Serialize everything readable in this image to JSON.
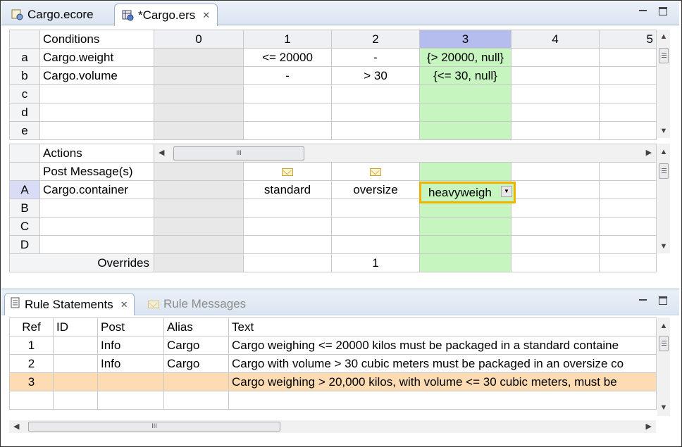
{
  "editor": {
    "tabs": [
      {
        "label": "Cargo.ecore",
        "icon": "ecore-model-icon",
        "active": false
      },
      {
        "label": "*Cargo.ers",
        "icon": "ruleflow-icon",
        "active": true
      }
    ]
  },
  "conditions": {
    "title": "Conditions",
    "columns": [
      "0",
      "1",
      "2",
      "3",
      "4",
      "5"
    ],
    "selected_column": "3",
    "rows": [
      {
        "label": "a",
        "name": "Cargo.weight",
        "cells": [
          "",
          "<= 20000",
          "-",
          "{> 20000, null}",
          "",
          ""
        ]
      },
      {
        "label": "b",
        "name": "Cargo.volume",
        "cells": [
          "",
          "-",
          "> 30",
          "{<= 30, null}",
          "",
          ""
        ]
      },
      {
        "label": "c",
        "name": "",
        "cells": [
          "",
          "",
          "",
          "",
          "",
          ""
        ]
      },
      {
        "label": "d",
        "name": "",
        "cells": [
          "",
          "",
          "",
          "",
          "",
          ""
        ]
      },
      {
        "label": "e",
        "name": "",
        "cells": [
          "",
          "",
          "",
          "",
          "",
          ""
        ]
      }
    ]
  },
  "actions": {
    "title": "Actions",
    "post_message_label": "Post Message(s)",
    "rows": [
      {
        "label": "A",
        "name": "Cargo.container",
        "cells": [
          "",
          "standard",
          "oversize",
          "heavyweigh",
          "",
          ""
        ]
      },
      {
        "label": "B",
        "name": "",
        "cells": [
          "",
          "",
          "",
          "",
          "",
          ""
        ]
      },
      {
        "label": "C",
        "name": "",
        "cells": [
          "",
          "",
          "",
          "",
          "",
          ""
        ]
      },
      {
        "label": "D",
        "name": "",
        "cells": [
          "",
          "",
          "",
          "",
          "",
          ""
        ]
      }
    ],
    "overrides_label": "Overrides",
    "overrides": [
      "",
      "",
      "1",
      "",
      "",
      ""
    ],
    "dropdown_value": "heavyweigh"
  },
  "bottom": {
    "tabs": [
      {
        "label": "Rule Statements",
        "active": true
      },
      {
        "label": "Rule Messages",
        "active": false
      }
    ],
    "headers": [
      "Ref",
      "ID",
      "Post",
      "Alias",
      "Text"
    ],
    "rows": [
      {
        "ref": "1",
        "id": "",
        "post": "Info",
        "alias": "Cargo",
        "text": "Cargo weighing <= 20000 kilos must be packaged in a standard containe",
        "selected": false
      },
      {
        "ref": "2",
        "id": "",
        "post": "Info",
        "alias": "Cargo",
        "text": "Cargo with volume > 30 cubic meters must be packaged in an oversize co",
        "selected": false
      },
      {
        "ref": "3",
        "id": "",
        "post": "",
        "alias": "",
        "text": "Cargo weighing > 20,000 kilos, with volume <= 30 cubic meters, must be",
        "selected": true
      }
    ]
  },
  "colors": {
    "selected_column_header": "#b5bcee",
    "selected_column": "#c6f5c0",
    "selected_row": "#fddcb4",
    "dropdown_border": "#f0b400"
  }
}
